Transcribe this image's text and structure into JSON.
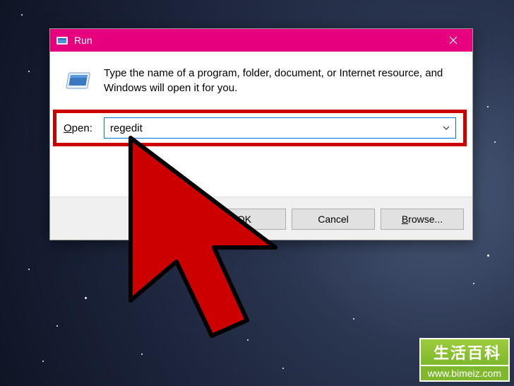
{
  "dialog": {
    "title": "Run",
    "info_text": "Type the name of a program, folder, document, or Internet resource, and Windows will open it for you.",
    "open_label_underline": "O",
    "open_label_rest": "pen:",
    "input_value": "regedit",
    "buttons": {
      "ok": "OK",
      "cancel": "Cancel",
      "browse_underline": "B",
      "browse_rest": "rowse..."
    }
  },
  "watermark": {
    "top": "生活百科",
    "bottom": "www.bimeiz.com"
  }
}
